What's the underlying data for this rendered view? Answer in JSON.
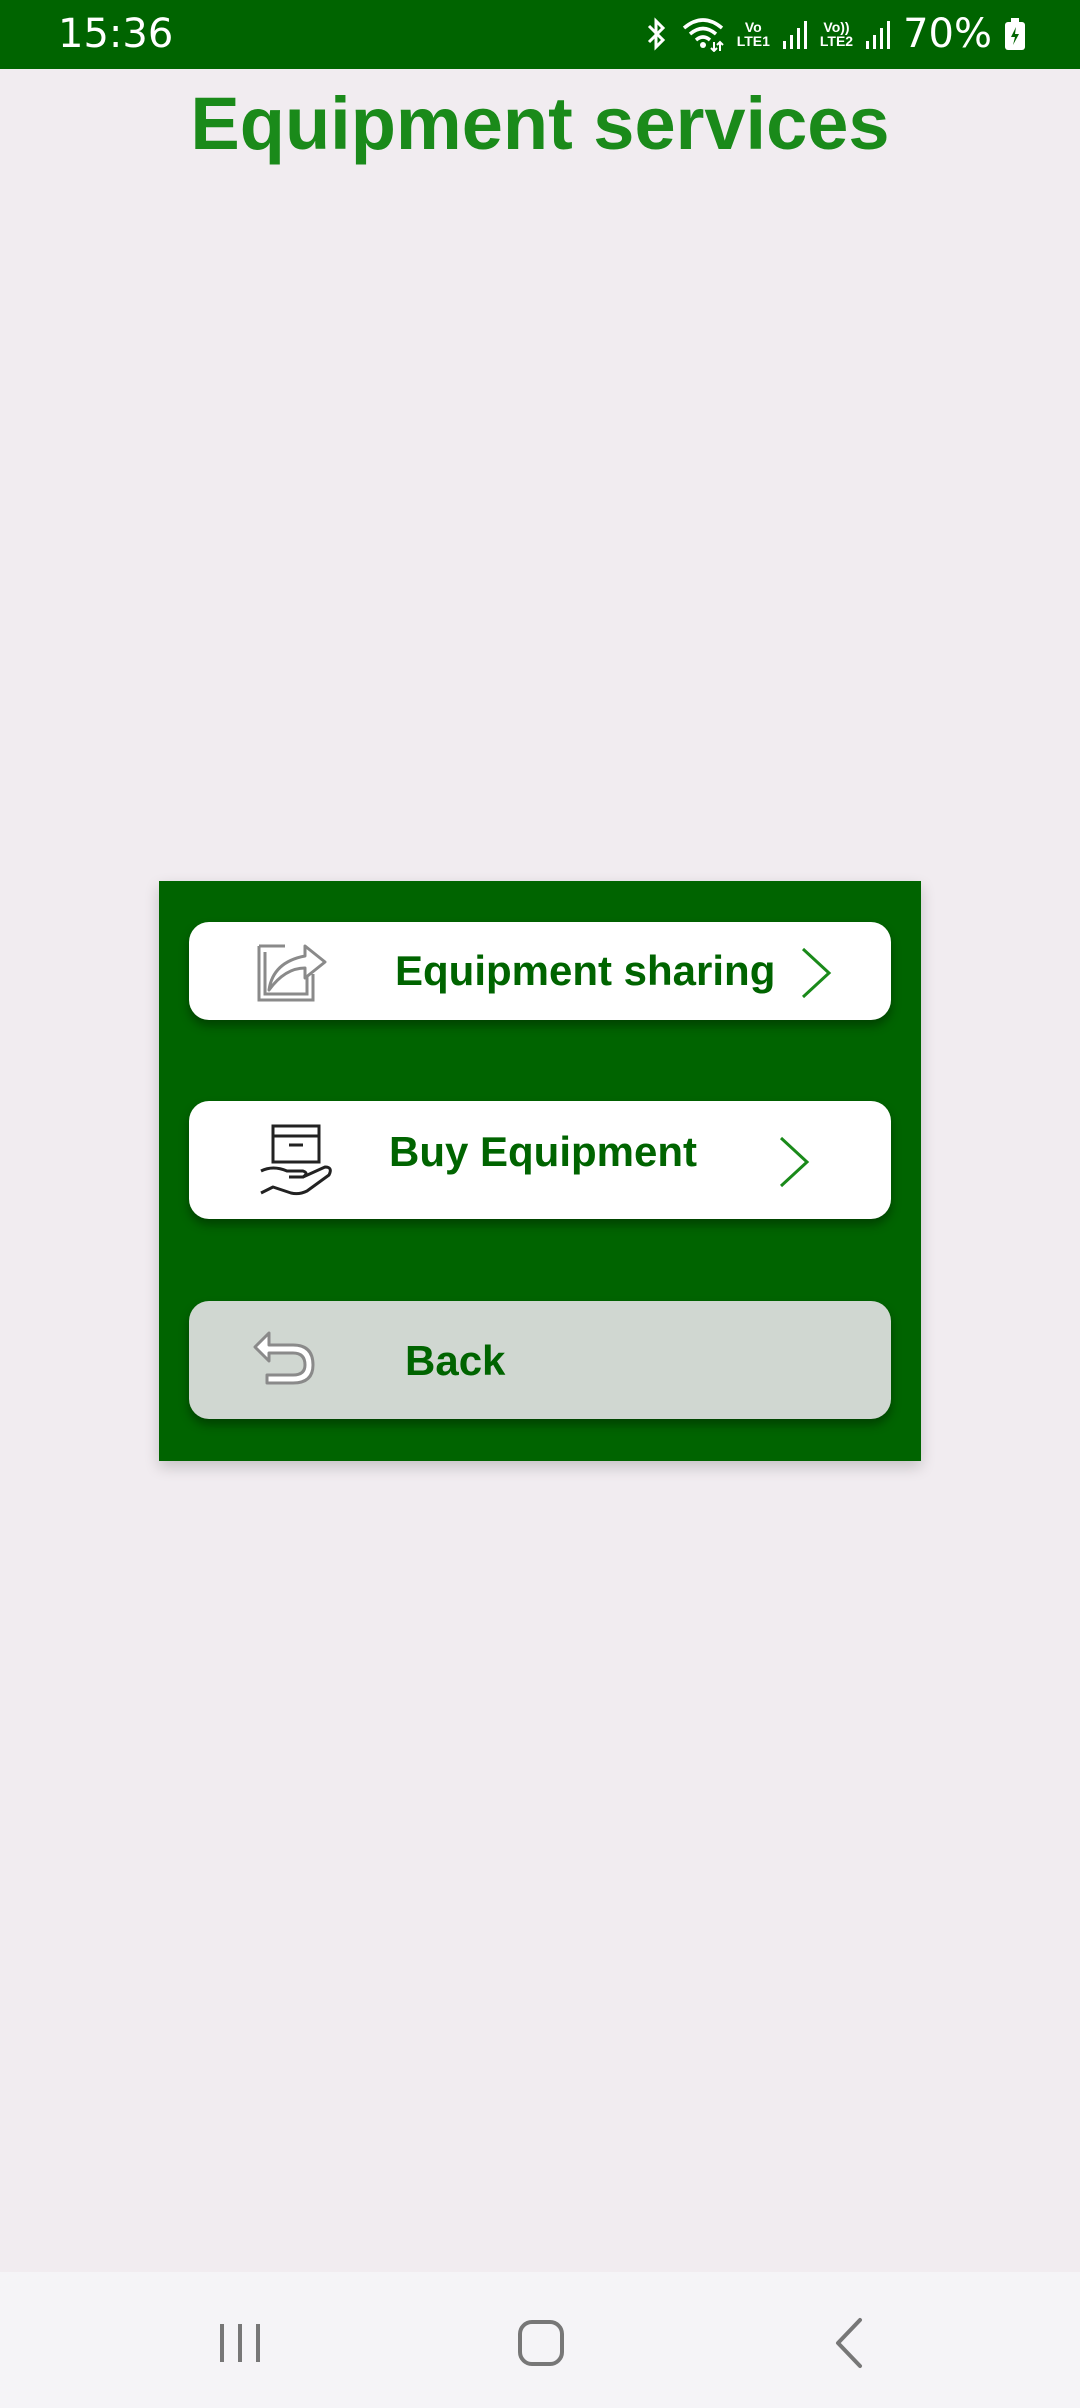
{
  "status_bar": {
    "time": "15:36",
    "lte1_top": "Vo",
    "lte1_bottom": "LTE1",
    "lte2_top": "Vo))",
    "lte2_bottom": "LTE2",
    "battery": "70%",
    "icons": [
      "bluetooth-icon",
      "wifi-icon",
      "signal-icon",
      "signal-icon",
      "battery-icon"
    ]
  },
  "page": {
    "title": "Equipment services"
  },
  "menu": {
    "items": [
      {
        "label": "Equipment sharing",
        "icon": "share-icon"
      },
      {
        "label": "Buy Equipment",
        "icon": "hand-box-icon"
      },
      {
        "label": "Back",
        "icon": "undo-arrow-icon"
      }
    ]
  },
  "colors": {
    "status_bar": "#006400",
    "title": "#1a8a1a",
    "panel": "#006400",
    "button": "#ffffff",
    "back_button": "#d0d7d1",
    "background": "#f1ecf0"
  },
  "nav_bar": {
    "icons": [
      "recents-icon",
      "home-icon",
      "back-icon"
    ]
  }
}
